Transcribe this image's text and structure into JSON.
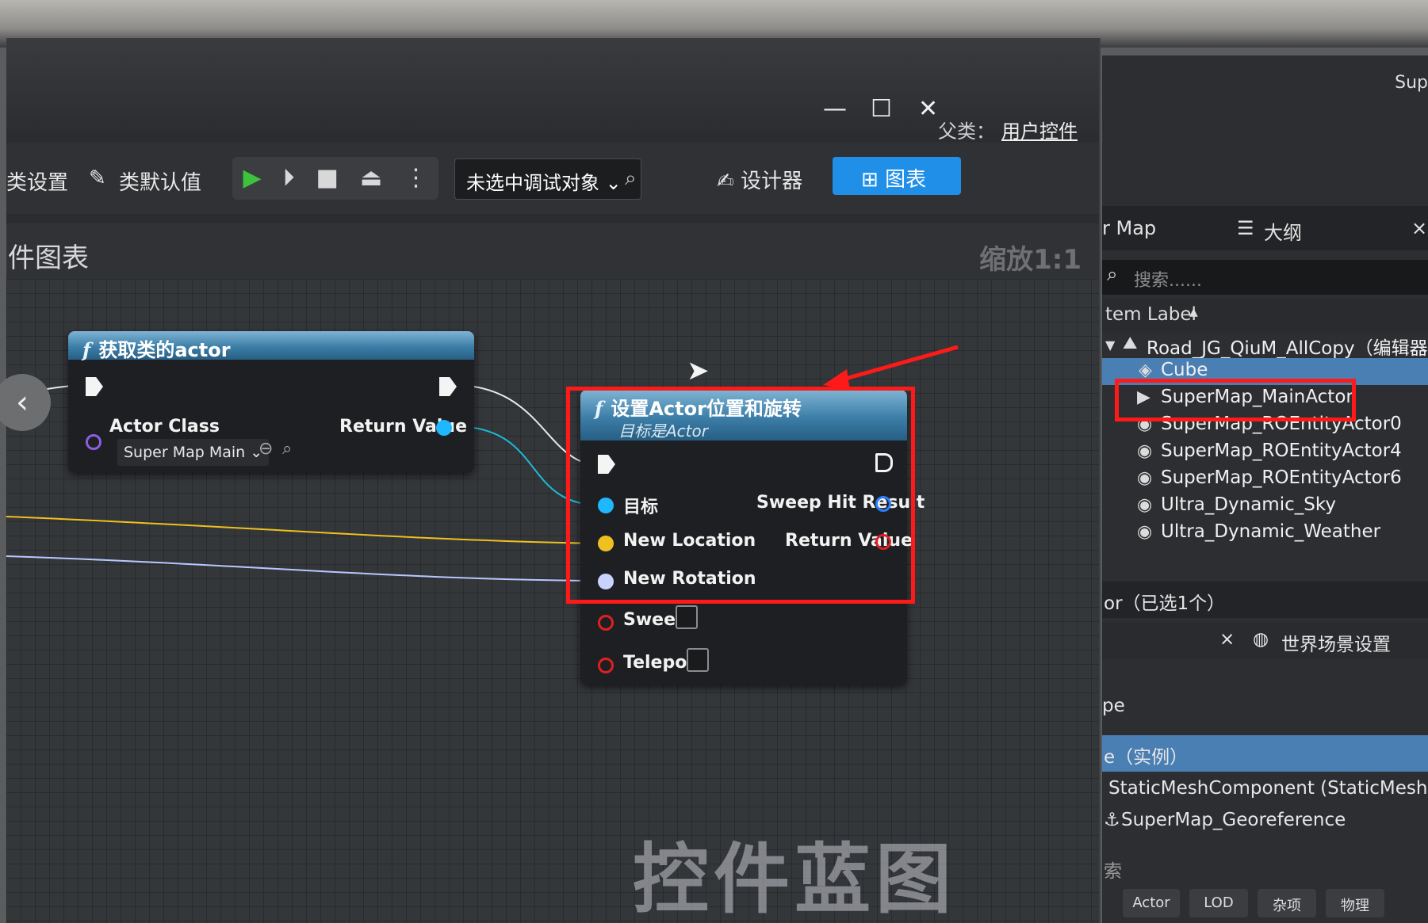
{
  "window": {
    "minimize": "—",
    "maximize": "☐",
    "close": "✕",
    "parent_label": "父类：",
    "parent_value": "用户控件"
  },
  "toolbar": {
    "class_settings": "类设置",
    "class_defaults": "类默认值",
    "debug_target": "未选中调试对象",
    "designer": "设计器",
    "graph": "图表"
  },
  "graph": {
    "title": "件图表",
    "zoom": "缩放1:1",
    "watermark": "控件蓝图"
  },
  "node_get_actor": {
    "title": "获取类的actor",
    "actor_class_label": "Actor Class",
    "class_value": "Super Map Main",
    "return_label": "Return Value"
  },
  "node_set_transform": {
    "title": "设置Actor位置和旋转",
    "subtitle": "目标是Actor",
    "target": "目标",
    "new_location": "New Location",
    "new_rotation": "New Rotation",
    "sweep": "Sweep",
    "teleport": "Teleport",
    "sweep_hit": "Sweep Hit Result",
    "return_label": "Return Value"
  },
  "outliner": {
    "top_text": "Sup",
    "tab_map": "r Map",
    "tab_outline": "大纲",
    "search_placeholder": "搜索......",
    "column": "tem Label",
    "items": [
      {
        "label": "Road_JG_QiuM_AllCopy（编辑器）",
        "icon": "level-icon"
      },
      {
        "label": "Cube",
        "icon": "cube-icon"
      },
      {
        "label": "SuperMap_MainActor",
        "icon": "camera-icon"
      },
      {
        "label": "SuperMap_ROEntityActor0",
        "icon": "actor-icon"
      },
      {
        "label": "SuperMap_ROEntityActor4",
        "icon": "actor-icon"
      },
      {
        "label": "SuperMap_ROEntityActor6",
        "icon": "actor-icon"
      },
      {
        "label": "Ultra_Dynamic_Sky",
        "icon": "actor-icon"
      },
      {
        "label": "Ultra_Dynamic_Weather",
        "icon": "actor-icon"
      }
    ],
    "selected_count": "or（已选1个）",
    "close_x": "×",
    "world_settings": "世界场景设置",
    "type_label": "pe",
    "instance_label": "e（实例）",
    "component": "StaticMeshComponent (StaticMeshCom",
    "georef": "SuperMap_Georeference",
    "footer_char": "索",
    "bottom_tabs": [
      "Actor",
      "LOD",
      "杂项",
      "物理"
    ]
  },
  "colors": {
    "accent": "#1f8fe8",
    "highlight": "#ff1a1a",
    "exec_wire": "#e8e8e8",
    "location_wire": "#f0c020",
    "rotation_wire": "#b8c8ff",
    "object_pin": "#1fb8ff"
  }
}
